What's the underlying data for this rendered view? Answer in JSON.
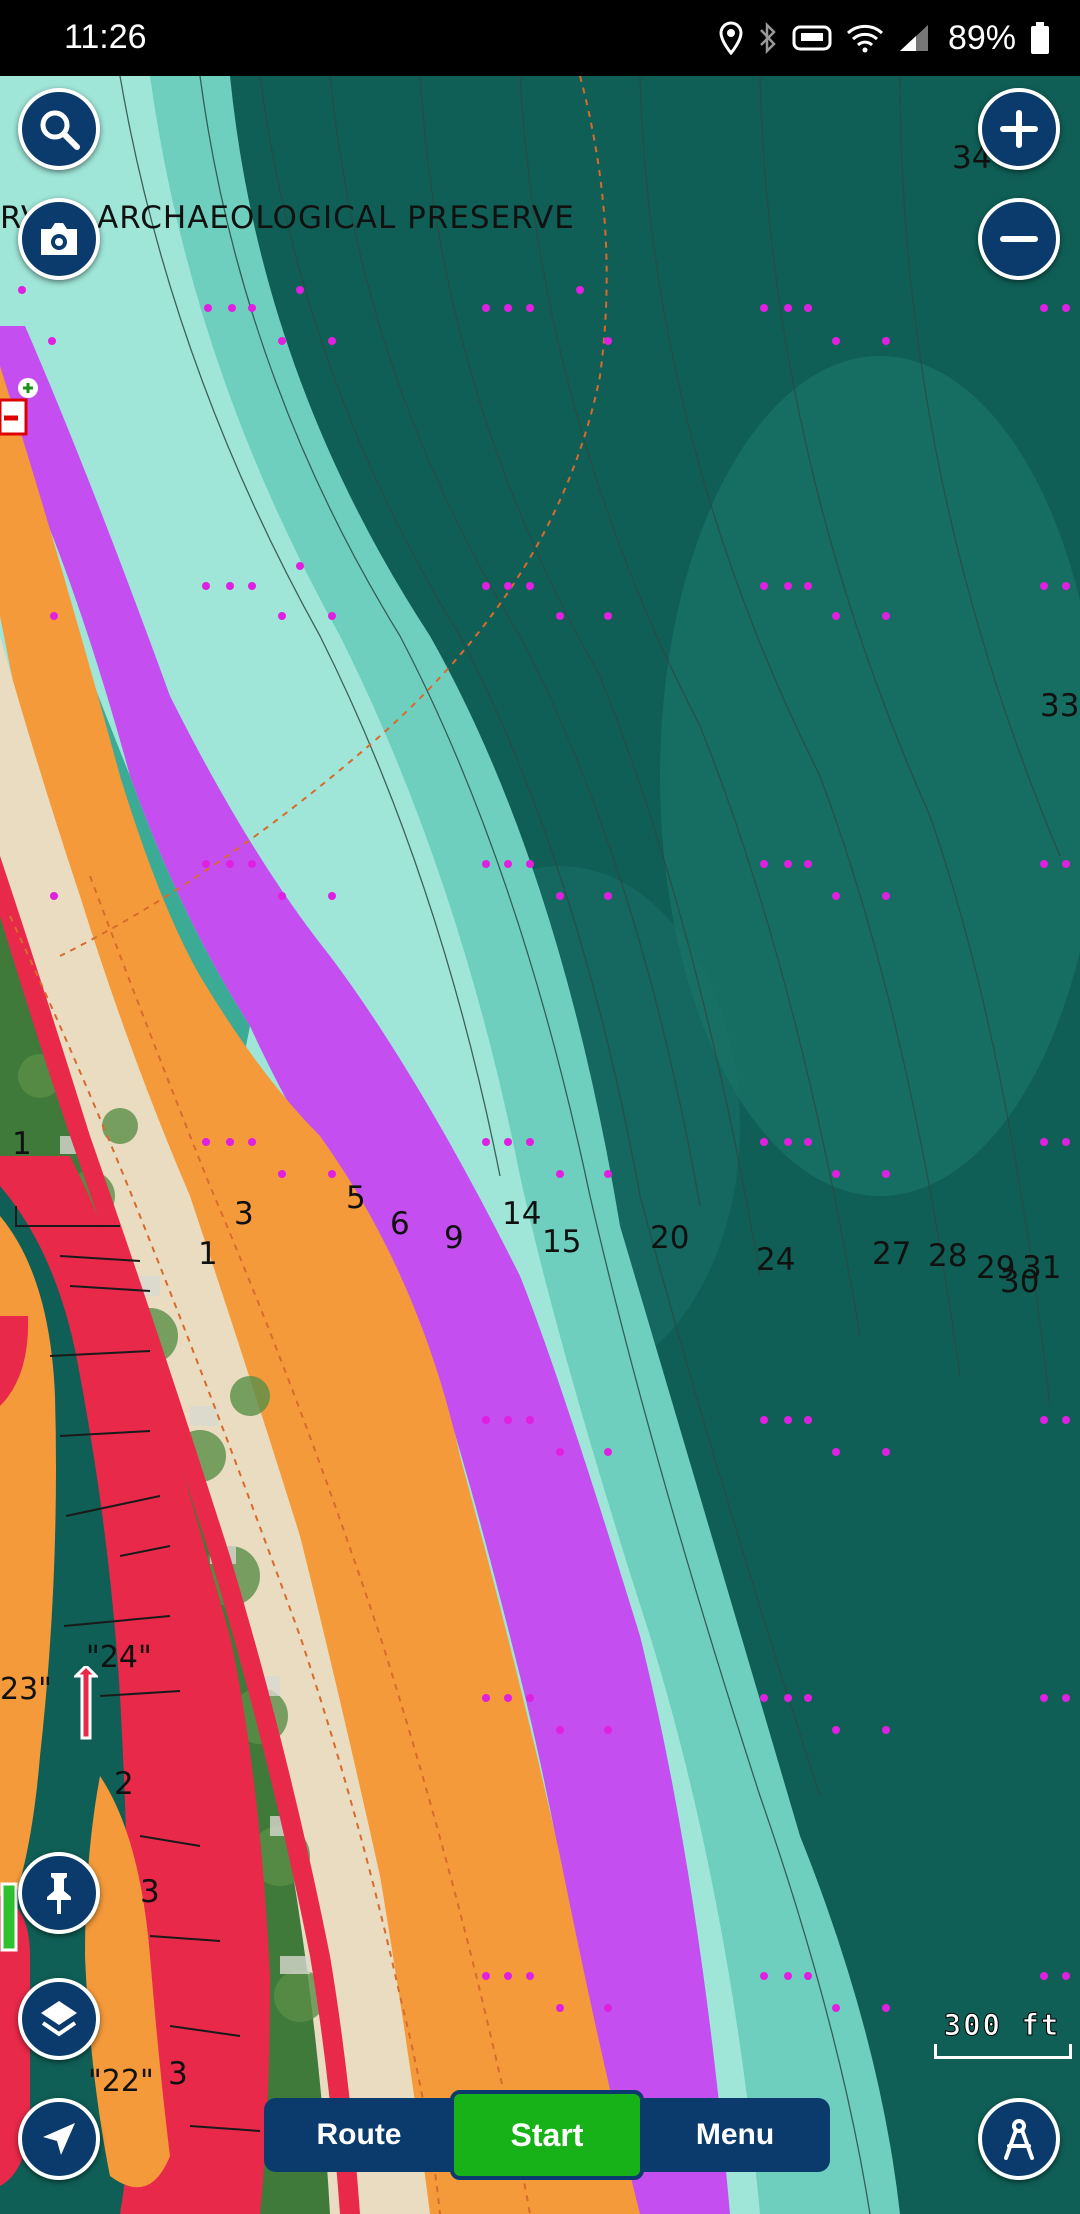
{
  "status_bar": {
    "time": "11:26",
    "battery": "89%"
  },
  "map": {
    "place_label": "RVER ARCHAEOLOGICAL PRESERVE",
    "depths": [
      "34",
      "33",
      "5",
      "6",
      "9",
      "14",
      "15",
      "20",
      "24",
      "27",
      "28",
      "29",
      "31",
      "30",
      "3",
      "1",
      "1",
      "2",
      "3",
      "3"
    ],
    "markers": [
      "\"24\"",
      "23\"",
      "\"22\""
    ],
    "scale_label": "300 ft"
  },
  "controls": {
    "search": "search-icon",
    "camera": "camera-icon",
    "zoom_in": "plus-icon",
    "zoom_out": "minus-icon",
    "pin": "pin-icon",
    "layers": "layers-icon",
    "locate": "navigation-arrow-icon",
    "compass": "compass-icon"
  },
  "bottom_bar": {
    "route": "Route",
    "start": "Start",
    "menu": "Menu"
  },
  "colors": {
    "deep_water": "#0f5f56",
    "shallow": "#8fe0d0",
    "purple": "#c44ef0",
    "orange": "#f59a3b",
    "red": "#e8294a",
    "start_green": "#16b217",
    "button_navy": "#0a3b6c"
  }
}
